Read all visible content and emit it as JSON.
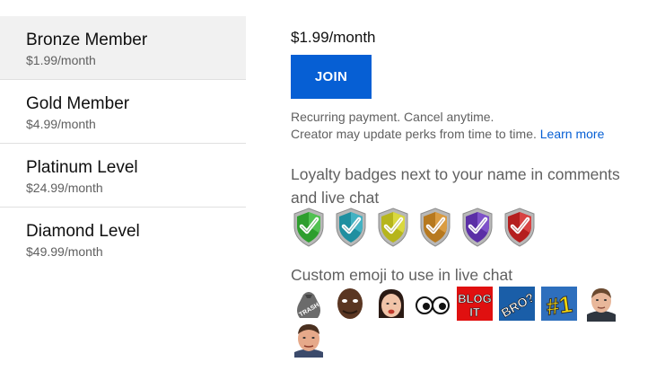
{
  "tiers": [
    {
      "name": "Bronze Member",
      "price": "$1.99/month",
      "selected": true
    },
    {
      "name": "Gold Member",
      "price": "$4.99/month",
      "selected": false
    },
    {
      "name": "Platinum Level",
      "price": "$24.99/month",
      "selected": false
    },
    {
      "name": "Diamond Level",
      "price": "$49.99/month",
      "selected": false
    }
  ],
  "detail": {
    "price": "$1.99/month",
    "join_label": "JOIN",
    "note_line1": "Recurring payment. Cancel anytime.",
    "note_line2": "Creator may update perks from time to time.",
    "learn_more": "Learn more"
  },
  "perks": {
    "badges_title_line1": "Loyalty badges next to your name in comments",
    "badges_title_line2": "and live chat",
    "badges": [
      {
        "name": "green-badge-icon",
        "color": "#2e9e2e"
      },
      {
        "name": "teal-badge-icon",
        "color": "#1f8fa0"
      },
      {
        "name": "yellow-badge-icon",
        "color": "#b6b51c"
      },
      {
        "name": "bronze-badge-icon",
        "color": "#b7791f"
      },
      {
        "name": "purple-badge-icon",
        "color": "#5b2fa6"
      },
      {
        "name": "red-badge-icon",
        "color": "#b51f1f"
      }
    ],
    "emoji_title": "Custom emoji to use in live chat",
    "emojis": [
      {
        "name": "trash-bag-emoji",
        "text": "TRASH"
      },
      {
        "name": "face-emoji-1",
        "text": ""
      },
      {
        "name": "face-emoji-2",
        "text": ""
      },
      {
        "name": "eyes-emoji",
        "text": ""
      },
      {
        "name": "blog-it-emoji",
        "text": "BLOG IT"
      },
      {
        "name": "bro-emoji",
        "text": "BRO?"
      },
      {
        "name": "number-one-emoji",
        "text": "#1"
      },
      {
        "name": "face-emoji-3",
        "text": ""
      },
      {
        "name": "face-emoji-4",
        "text": ""
      }
    ]
  }
}
